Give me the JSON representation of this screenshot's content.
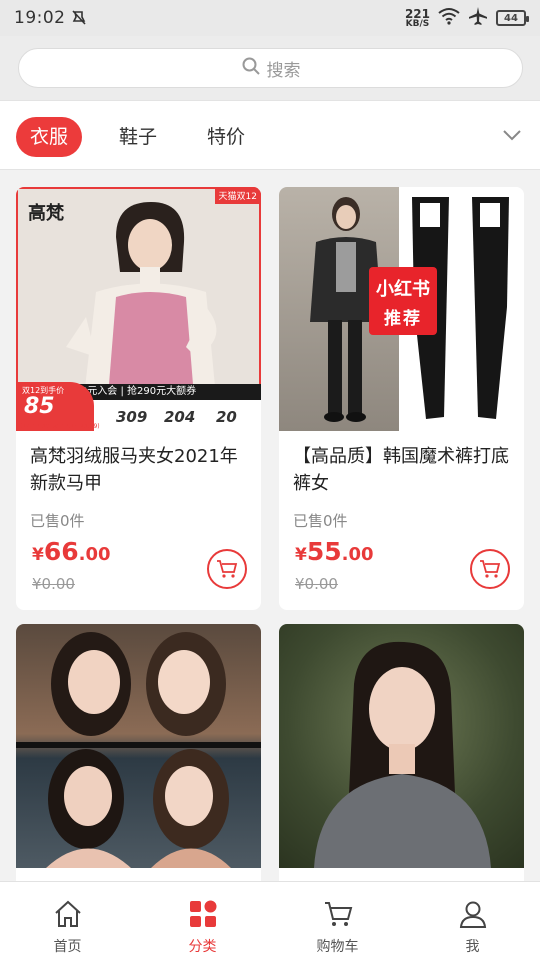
{
  "status_bar": {
    "time": "19:02",
    "net_speed_value": "221",
    "net_speed_unit": "KB/S",
    "battery": "44"
  },
  "search": {
    "placeholder": "搜索"
  },
  "categories": [
    {
      "label": "衣服",
      "active": true
    },
    {
      "label": "鞋子",
      "active": false
    },
    {
      "label": "特价",
      "active": false
    }
  ],
  "products": [
    {
      "title": "高梵羽绒服马夹女2021年新款马甲",
      "sold": "已售0件",
      "price_currency": "¥",
      "price_int": "66",
      "price_dec": ".00",
      "original_price": "¥0.00",
      "image": {
        "brand": "高梵",
        "tag": "天猫双12",
        "promo_text": "0元入会 | 抢290元大额券",
        "badge_label": "双12到手价",
        "badge_price": "85",
        "badge_date": "(12.12 00:00-12.14 23:59)",
        "stat_prices": [
          "309",
          "204",
          "20"
        ]
      }
    },
    {
      "title": "【高品质】韩国魔术裤打底裤女",
      "sold": "已售0件",
      "price_currency": "¥",
      "price_int": "55",
      "price_dec": ".00",
      "original_price": "¥0.00",
      "image": {
        "sticker_line1": "小红书",
        "sticker_line2": "推荐"
      }
    },
    {
      "title": "",
      "image": {}
    },
    {
      "title": "",
      "image": {}
    }
  ],
  "bottom_nav": [
    {
      "label": "首页",
      "icon": "home-icon",
      "active": false
    },
    {
      "label": "分类",
      "icon": "category-icon",
      "active": true
    },
    {
      "label": "购物车",
      "icon": "cart-icon",
      "active": false
    },
    {
      "label": "我",
      "icon": "user-icon",
      "active": false
    }
  ],
  "colors": {
    "accent": "#e83a3a",
    "page_bg": "#f2f2f2"
  }
}
